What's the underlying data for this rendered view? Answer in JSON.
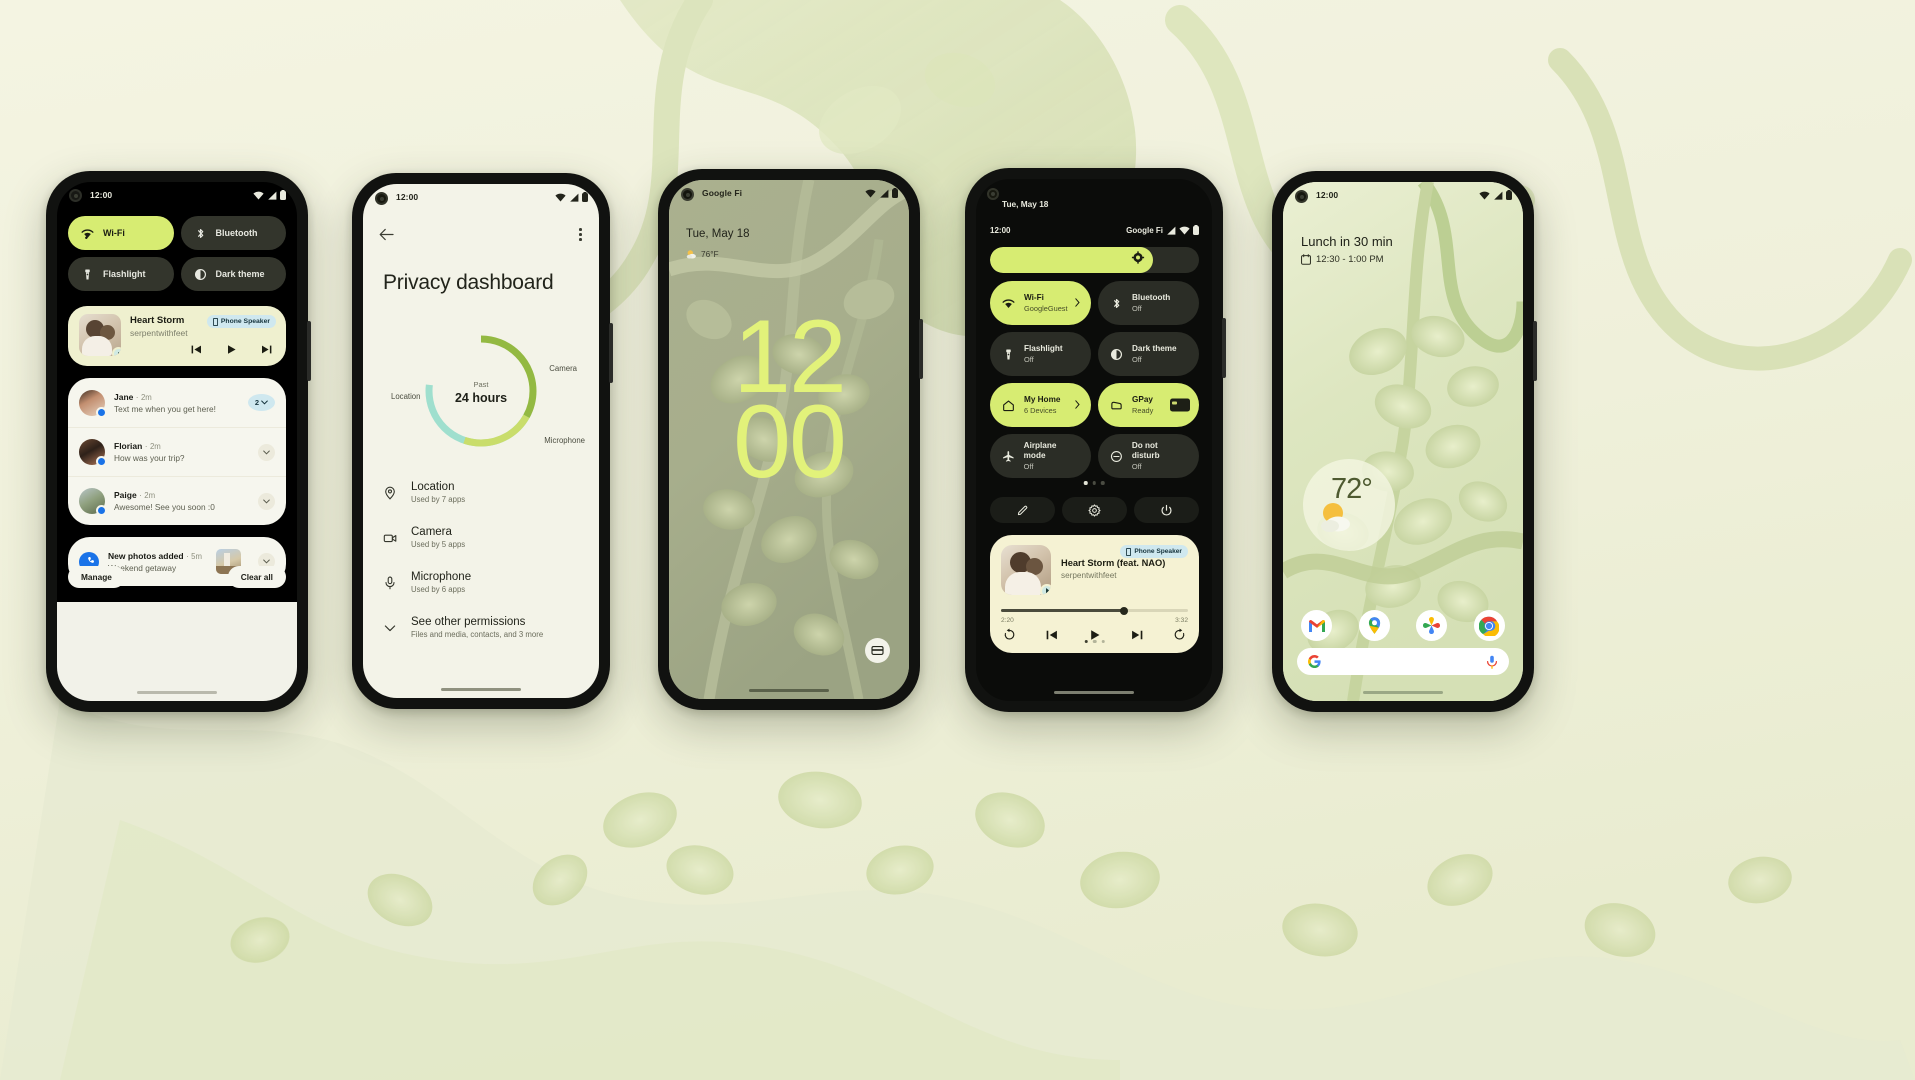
{
  "background": {
    "color": "#f2f3e0",
    "accent": "#d7ec72",
    "dark": "#2b2d26"
  },
  "phone1": {
    "name": "notification-shade",
    "status": {
      "time": "12:00"
    },
    "quick_tiles": [
      {
        "label": "Wi-Fi",
        "icon": "wifi-icon",
        "state": "on"
      },
      {
        "label": "Bluetooth",
        "icon": "bluetooth-icon",
        "state": "off"
      },
      {
        "label": "Flashlight",
        "icon": "flashlight-icon",
        "state": "off"
      },
      {
        "label": "Dark theme",
        "icon": "dark-theme-icon",
        "state": "off"
      }
    ],
    "media": {
      "title": "Heart Storm",
      "artist": "serpentwithfeet",
      "output_chip": "Phone Speaker"
    },
    "notifications": [
      {
        "sender": "Jane",
        "sep": "·",
        "time": "2m",
        "message": "Text me when you get here!",
        "count": "2"
      },
      {
        "sender": "Florian",
        "sep": "·",
        "time": "2m",
        "message": "How was your trip?",
        "count": ""
      },
      {
        "sender": "Paige",
        "sep": "·",
        "time": "2m",
        "message": "Awesome! See you soon :0",
        "count": ""
      }
    ],
    "photos_notification": {
      "title": "New photos added",
      "sep": "·",
      "time": "5m",
      "message": "Weekend getaway"
    },
    "actions": {
      "manage": "Manage",
      "clear_all": "Clear all"
    }
  },
  "phone2": {
    "name": "privacy-dashboard",
    "status": {
      "time": "12:00"
    },
    "title": "Privacy dashboard",
    "chart_data": {
      "type": "pie",
      "title": "Past 24 hours",
      "center_label_top": "Past",
      "center_label_main": "24 hours",
      "categories": [
        "Location",
        "Camera",
        "Microphone"
      ],
      "values": [
        45,
        33,
        22
      ],
      "colors": [
        "#9fdfce",
        "#93b942",
        "#c9dd6b"
      ],
      "legend_position": "around-donut",
      "grid": false
    },
    "donut_labels": {
      "location": "Location",
      "camera": "Camera",
      "microphone": "Microphone"
    },
    "permissions": [
      {
        "name": "Location",
        "sub": "Used by 7 apps",
        "icon": "location-pin-icon"
      },
      {
        "name": "Camera",
        "sub": "Used by 5 apps",
        "icon": "camera-icon"
      },
      {
        "name": "Microphone",
        "sub": "Used by 6 apps",
        "icon": "microphone-icon"
      }
    ],
    "see_other": {
      "name": "See other permissions",
      "sub": "Files and media, contacts, and 3 more"
    }
  },
  "phone3": {
    "name": "lock-screen",
    "carrier": "Google Fi",
    "date": "Tue, May 18",
    "weather": "76°F",
    "clock_hours": "12",
    "clock_minutes": "00"
  },
  "phone4": {
    "name": "quick-settings-expanded",
    "date": "Tue, May 18",
    "time": "12:00",
    "carrier": "Google Fi",
    "brightness_percent": "78",
    "tiles": [
      {
        "label": "Wi-Fi",
        "sub": "GoogleGuest",
        "icon": "wifi-icon",
        "state": "on",
        "chevron": true
      },
      {
        "label": "Bluetooth",
        "sub": "Off",
        "icon": "bluetooth-icon",
        "state": "off",
        "chevron": false
      },
      {
        "label": "Flashlight",
        "sub": "Off",
        "icon": "flashlight-icon",
        "state": "off",
        "chevron": false
      },
      {
        "label": "Dark theme",
        "sub": "Off",
        "icon": "dark-theme-icon",
        "state": "off",
        "chevron": false
      },
      {
        "label": "My Home",
        "sub": "6 Devices",
        "icon": "home-icon",
        "state": "on",
        "chevron": true
      },
      {
        "label": "GPay",
        "sub": "Ready",
        "icon": "wallet-icon",
        "state": "on",
        "chevron": false
      },
      {
        "label": "Airplane mode",
        "sub": "Off",
        "icon": "airplane-icon",
        "state": "off",
        "chevron": false
      },
      {
        "label": "Do not disturb",
        "sub": "Off",
        "icon": "do-not-disturb-icon",
        "state": "off",
        "chevron": false
      }
    ],
    "footer_buttons": [
      {
        "icon": "edit-pencil-icon"
      },
      {
        "icon": "settings-gear-icon"
      },
      {
        "icon": "power-icon"
      }
    ],
    "media": {
      "title": "Heart Storm (feat. NAO)",
      "artist": "serpentwithfeet",
      "output_chip": "Phone Speaker",
      "elapsed": "2:20",
      "duration": "3:32",
      "progress_percent": "66"
    }
  },
  "phone5": {
    "name": "home-screen",
    "status": {
      "time": "12:00"
    },
    "calendar": {
      "headline": "Lunch in 30 min",
      "time_range": "12:30 - 1:00 PM"
    },
    "weather": {
      "temperature": "72°",
      "icon": "sun-cloud-icon"
    },
    "dock": [
      {
        "name": "gmail-icon"
      },
      {
        "name": "maps-icon"
      },
      {
        "name": "photos-icon"
      },
      {
        "name": "chrome-icon"
      }
    ],
    "search": {
      "google_icon": "google-g-icon",
      "mic_icon": "microphone-icon"
    }
  }
}
